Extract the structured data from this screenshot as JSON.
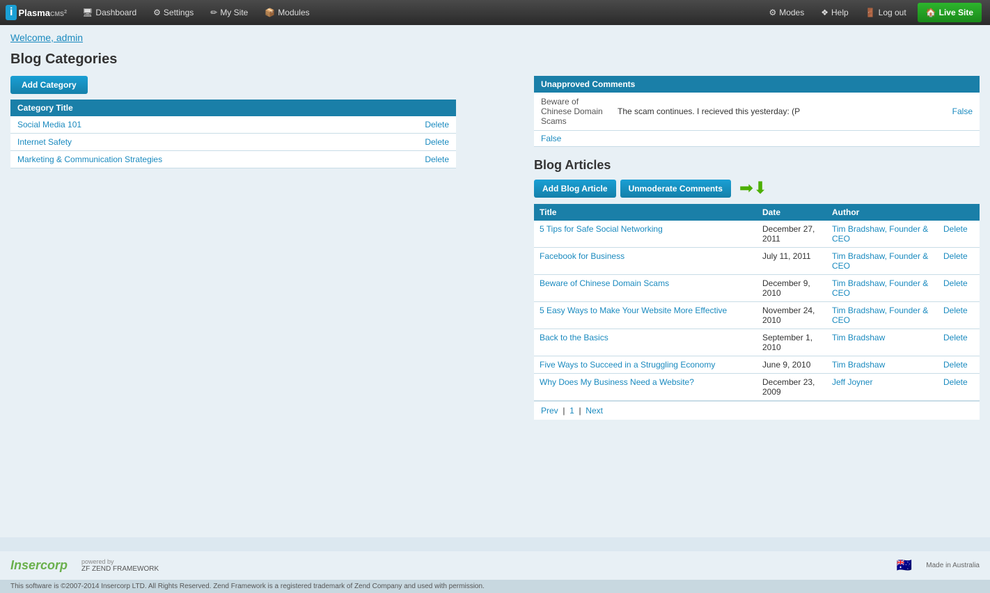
{
  "nav": {
    "logo_i": "i",
    "logo_name": "Plasma",
    "logo_cms": "CMS",
    "logo_version": "2",
    "items": [
      {
        "label": "Dashboard",
        "icon": "🖥"
      },
      {
        "label": "Settings",
        "icon": "⚙"
      },
      {
        "label": "My Site",
        "icon": "✏"
      },
      {
        "label": "Modules",
        "icon": "📦"
      }
    ],
    "right_items": [
      {
        "label": "Modes",
        "icon": "⚙"
      },
      {
        "label": "Help",
        "icon": "❖"
      },
      {
        "label": "Log out",
        "icon": "🚪"
      }
    ],
    "live_site": "Live Site"
  },
  "welcome": "Welcome, admin",
  "page_title": "Blog Categories",
  "add_category_label": "Add Category",
  "category_table_header": "Category Title",
  "categories": [
    {
      "title": "Social Media 101",
      "delete": "Delete"
    },
    {
      "title": "Internet Safety",
      "delete": "Delete"
    },
    {
      "title": "Marketing & Communication Strategies",
      "delete": "Delete"
    }
  ],
  "unapproved": {
    "header": "Unapproved Comments",
    "rows": [
      {
        "article": "Beware of Chinese Domain Scams",
        "comment": "The scam continues.  I recieved this yesterday:  (P",
        "action": "False"
      }
    ],
    "false_standalone": "False"
  },
  "blog_articles": {
    "title": "Blog Articles",
    "add_btn": "Add Blog Article",
    "unmoderate_btn": "Unmoderate Comments",
    "columns": [
      "Title",
      "Date",
      "Author",
      ""
    ],
    "rows": [
      {
        "title": "5 Tips for Safe Social Networking",
        "date": "December 27, 2011",
        "author": "Tim Bradshaw, Founder & CEO",
        "delete": "Delete"
      },
      {
        "title": "Facebook for Business",
        "date": "July 11, 2011",
        "author": "Tim Bradshaw, Founder & CEO",
        "delete": "Delete"
      },
      {
        "title": "Beware of Chinese Domain Scams",
        "date": "December 9, 2010",
        "author": "Tim Bradshaw, Founder & CEO",
        "delete": "Delete"
      },
      {
        "title": "5 Easy Ways to Make Your Website More Effective",
        "date": "November 24, 2010",
        "author": "Tim Bradshaw, Founder & CEO",
        "delete": "Delete"
      },
      {
        "title": "Back to the Basics",
        "date": "September 1, 2010",
        "author": "Tim Bradshaw",
        "delete": "Delete"
      },
      {
        "title": "Five Ways to Succeed in a Struggling Economy",
        "date": "June 9, 2010",
        "author": "Tim Bradshaw",
        "delete": "Delete"
      },
      {
        "title": "Why Does My Business Need a Website?",
        "date": "December 23, 2009",
        "author": "Jeff Joyner",
        "delete": "Delete"
      }
    ],
    "pagination": {
      "prev": "Prev",
      "current": "1",
      "next": "Next"
    }
  },
  "footer": {
    "powered_by": "powered by",
    "insercorp": "Insercorp",
    "zend": "ZEND FRAMEWORK",
    "made_in": "Made in Australia",
    "copyright": "This software is ©2007-2014 Insercorp LTD. All Rights Reserved. Zend Framework is a registered trademark of Zend Company and used with permission."
  }
}
